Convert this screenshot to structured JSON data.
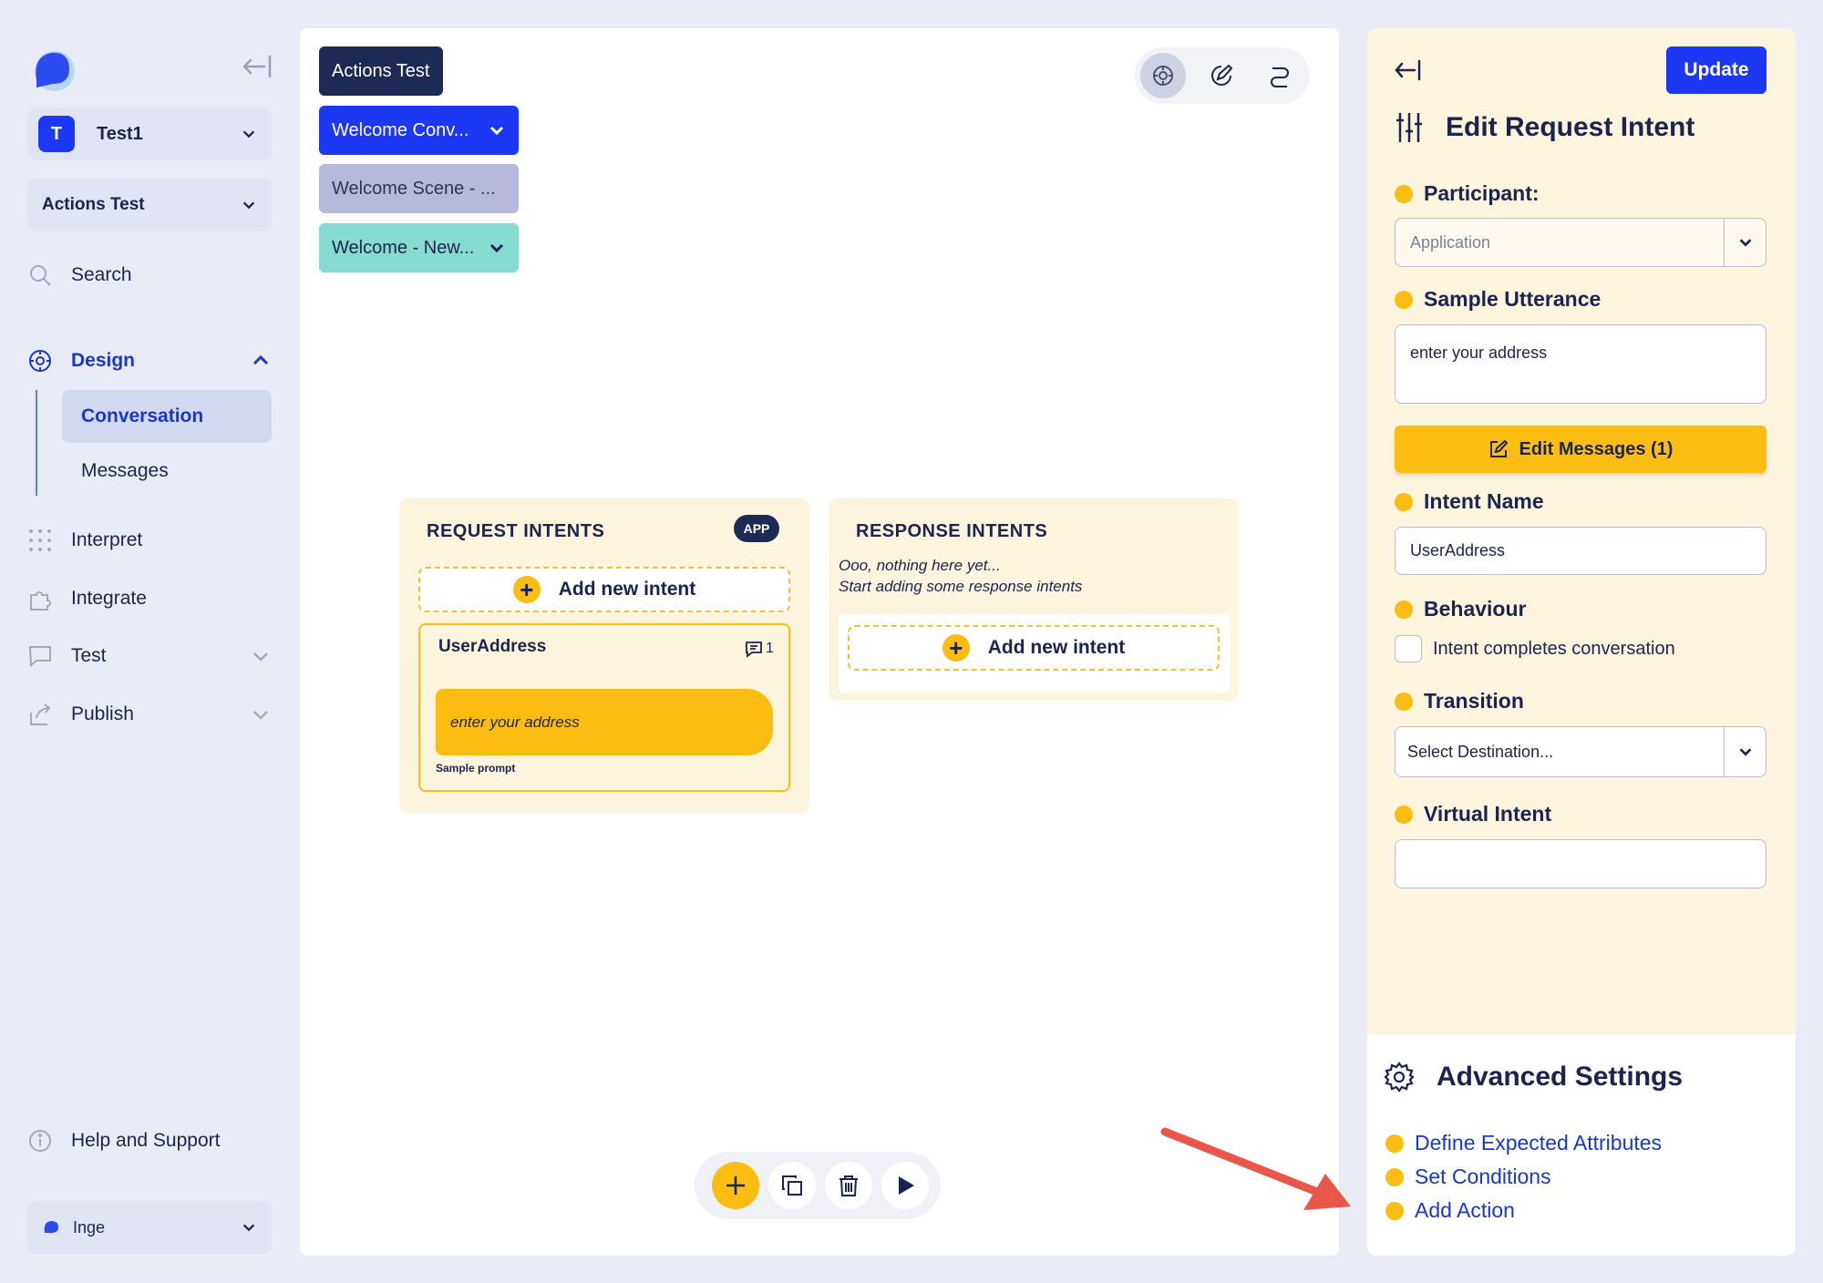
{
  "sidebar": {
    "workspace": {
      "initial": "T",
      "name": "Test1"
    },
    "project": "Actions Test",
    "search": "Search",
    "design": "Design",
    "design_children": [
      "Conversation",
      "Messages"
    ],
    "items": [
      "Interpret",
      "Integrate",
      "Test",
      "Publish"
    ],
    "help": "Help and Support",
    "user": "Inge"
  },
  "canvas": {
    "chips": [
      "Actions Test",
      "Welcome Conv...",
      "Welcome Scene - ...",
      "Welcome - New..."
    ],
    "request": {
      "title": "REQUEST INTENTS",
      "badge": "APP",
      "add": "Add new intent",
      "card": {
        "name": "UserAddress",
        "msg_count": "1",
        "utterance": "enter your address",
        "caption": "Sample prompt"
      }
    },
    "response": {
      "title": "RESPONSE INTENTS",
      "empty1": "Ooo, nothing here yet...",
      "empty2": "Start adding some response intents",
      "add": "Add new intent"
    }
  },
  "editor": {
    "update": "Update",
    "title": "Edit Request Intent",
    "participant_label": "Participant:",
    "participant_value": "Application",
    "utterance_label": "Sample Utterance",
    "utterance_value": "enter your address",
    "edit_messages": "Edit Messages (1)",
    "intent_name_label": "Intent Name",
    "intent_name_value": "UserAddress",
    "behaviour_label": "Behaviour",
    "behaviour_checkbox": "Intent completes conversation",
    "transition_label": "Transition",
    "transition_value": "Select Destination...",
    "virtual_label": "Virtual Intent",
    "virtual_value": ""
  },
  "advanced": {
    "title": "Advanced Settings",
    "items": [
      "Define Expected Attributes",
      "Set Conditions",
      "Add Action"
    ]
  },
  "colors": {
    "accent": "#fbbd12",
    "brand": "#1d38f5",
    "navy": "#1b2450",
    "link": "#1938c7",
    "annotation_arrow": "#e8574a"
  }
}
